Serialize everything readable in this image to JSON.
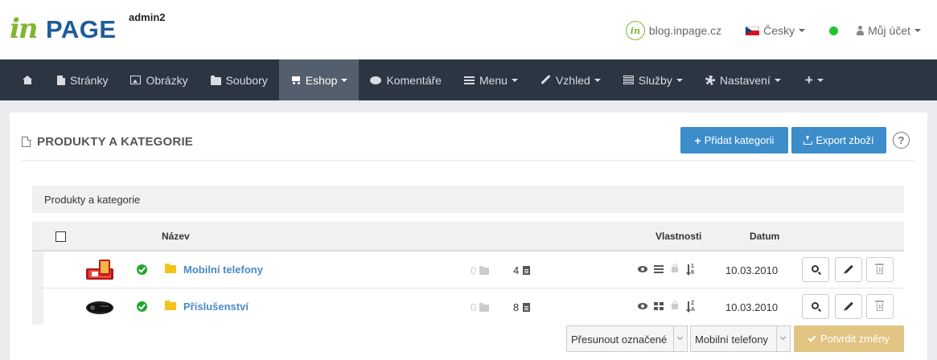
{
  "header": {
    "logo_in": "in",
    "logo_page": "PAGE",
    "user": "admin2",
    "blog_badge": "in",
    "blog_link": "blog.inpage.cz",
    "language": "Česky",
    "status_color": "#22c32e",
    "account": "Můj účet"
  },
  "nav": {
    "items": [
      {
        "label": "",
        "icon": "home-icon"
      },
      {
        "label": "Stránky",
        "icon": "file-icon"
      },
      {
        "label": "Obrázky",
        "icon": "image-icon"
      },
      {
        "label": "Soubory",
        "icon": "folder-icon"
      },
      {
        "label": "Eshop",
        "icon": "cart-icon",
        "active": true
      },
      {
        "label": "Komentáře",
        "icon": "comments-icon"
      },
      {
        "label": "Menu",
        "icon": "list-icon"
      },
      {
        "label": "Vzhled",
        "icon": "brush-icon"
      },
      {
        "label": "Služby",
        "icon": "server-icon"
      },
      {
        "label": "Nastavení",
        "icon": "gear-icon"
      },
      {
        "label": "",
        "icon": "plus-icon"
      }
    ]
  },
  "panel": {
    "title": "PRODUKTY A KATEGORIE",
    "add_category": "Přidat kategorii",
    "export": "Export zboží",
    "help": "?",
    "breadcrumb": "Produkty a kategorie",
    "columns": {
      "name": "Název",
      "properties": "Vlastnosti",
      "date": "Datum"
    },
    "rows": [
      {
        "name": "Mobilní telefony",
        "folders": "0",
        "pages": "4",
        "date": "10.03.2010",
        "active": true,
        "thumb": "phone-thumbnail"
      },
      {
        "name": "Příslušenství",
        "folders": "0",
        "pages": "8",
        "date": "10.03.2010",
        "active": true,
        "thumb": "projector-thumbnail"
      }
    ],
    "sort_icons": [
      {
        "top": "1",
        "bottom": "9"
      },
      {
        "top": "Z",
        "bottom": "A"
      }
    ],
    "move_select": "Přesunout označené",
    "target_select": "Mobilní telefony",
    "confirm": "Potvrdit změny"
  },
  "colors": {
    "navbar": "#2c3542",
    "nav_active": "#535f6c",
    "primary_button": "#3c8dca",
    "confirm_button": "#e2c483",
    "link": "#4a89c8",
    "logo_green": "#7db72f",
    "logo_blue": "#1f5b99"
  }
}
